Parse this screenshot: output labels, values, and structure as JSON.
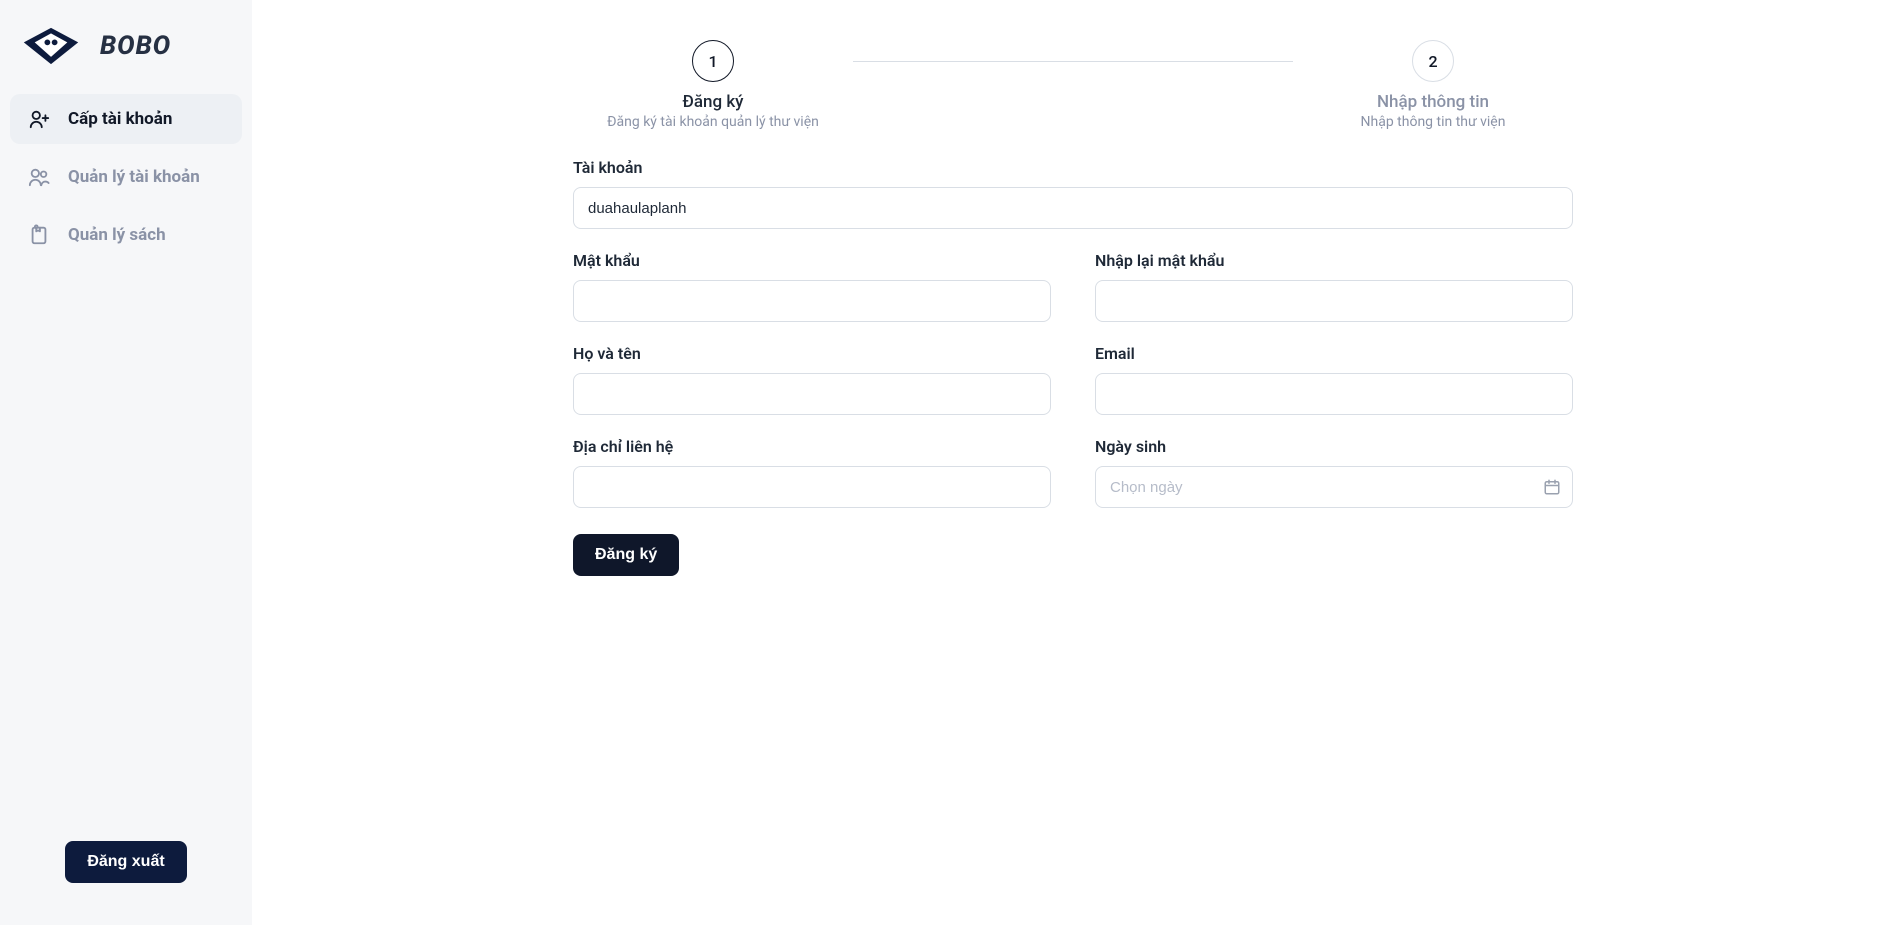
{
  "brand": {
    "name": "BOBO"
  },
  "sidebar": {
    "items": [
      {
        "label": "Cấp tài khoản",
        "active": true
      },
      {
        "label": "Quản lý tài khoản",
        "active": false
      },
      {
        "label": "Quản lý sách",
        "active": false
      }
    ],
    "logout_label": "Đăng xuất"
  },
  "steps": [
    {
      "num": "1",
      "title": "Đăng ký",
      "desc": "Đăng ký tài khoản quản lý thư viện",
      "active": true
    },
    {
      "num": "2",
      "title": "Nhập thông tin",
      "desc": "Nhập thông tin thư viện",
      "active": false
    }
  ],
  "form": {
    "username_label": "Tài khoản",
    "username_value": "duahaulaplanh",
    "password_label": "Mật khẩu",
    "password_value": "",
    "password2_label": "Nhập lại mật khẩu",
    "password2_value": "",
    "fullname_label": "Họ và tên",
    "fullname_value": "",
    "email_label": "Email",
    "email_value": "",
    "address_label": "Địa chỉ liên hệ",
    "address_value": "",
    "dob_label": "Ngày sinh",
    "dob_placeholder": "Chọn ngày",
    "dob_value": "",
    "submit_label": "Đăng ký"
  }
}
